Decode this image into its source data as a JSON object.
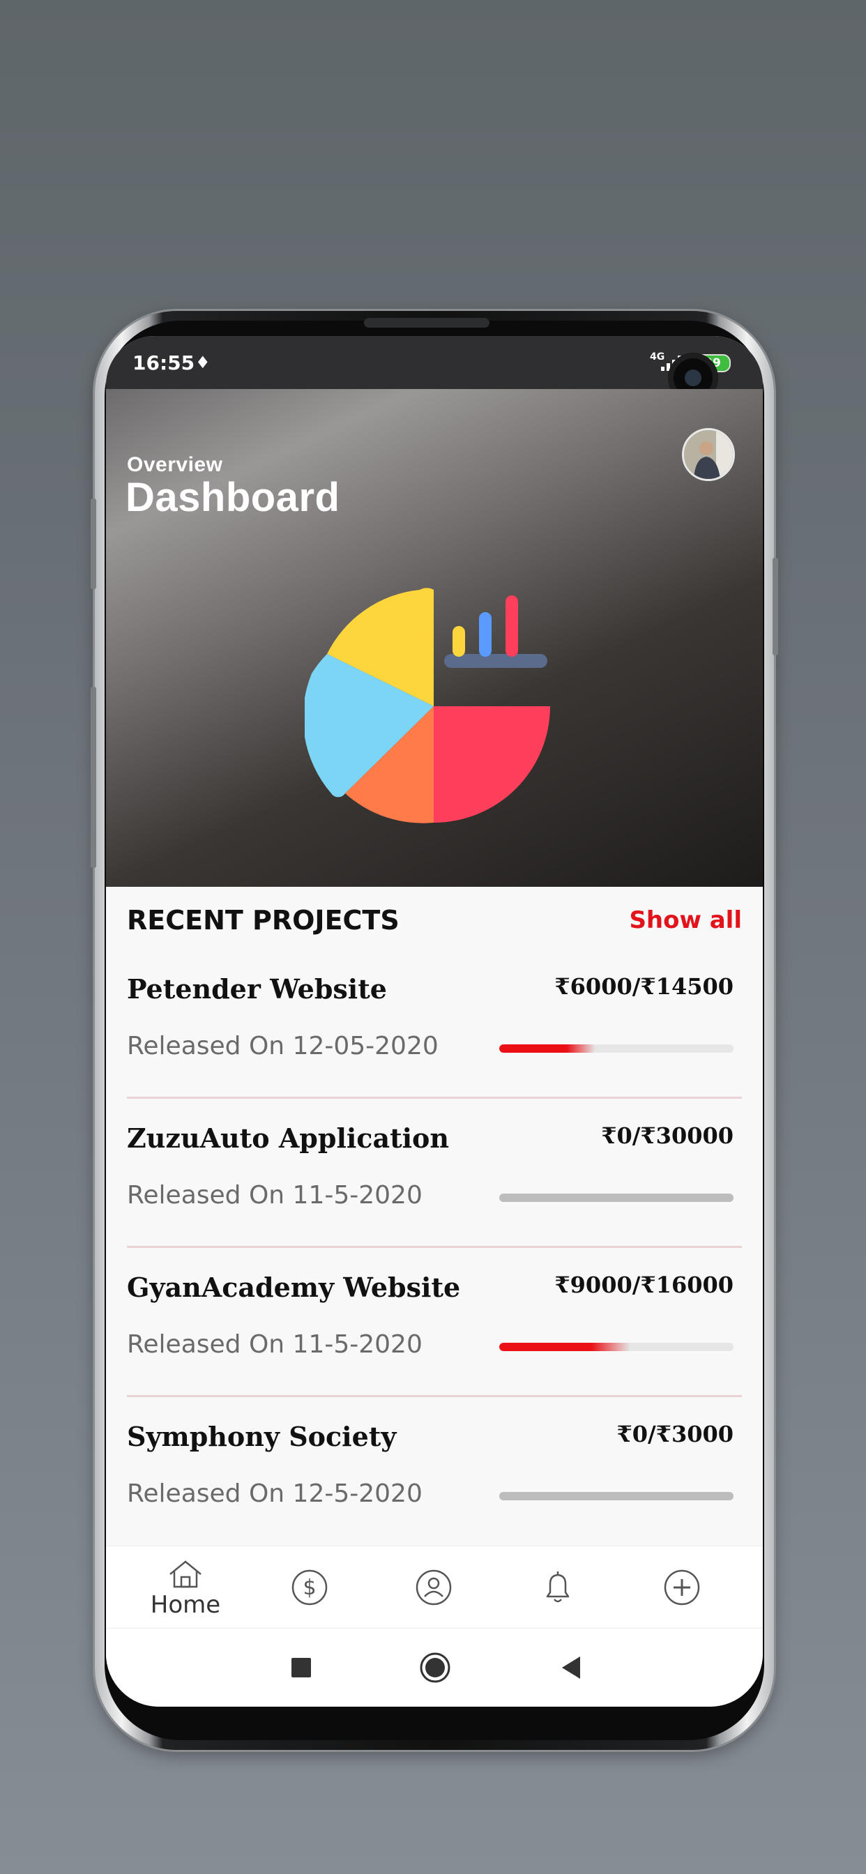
{
  "status_bar": {
    "time": "16:55",
    "network": "4G",
    "battery": "39"
  },
  "header": {
    "subtitle": "Overview",
    "title": "Dashboard"
  },
  "recent_projects": {
    "heading": "RECENT PROJECTS",
    "show_all_label": "Show all",
    "items": [
      {
        "name": "Petender Website",
        "amount": "₹6000/₹14500",
        "released": "Released On 12-05-2020",
        "progress": 0.41,
        "fill_color": "#ea1016"
      },
      {
        "name": "ZuzuAuto Application",
        "amount": "₹0/₹30000",
        "released": "Released On 11-5-2020",
        "progress": 0,
        "fill_color": "#ea1016"
      },
      {
        "name": "GyanAcademy Website",
        "amount": "₹9000/₹16000",
        "released": "Released On 11-5-2020",
        "progress": 0.56,
        "fill_color": "#ea1016"
      },
      {
        "name": "Symphony Society",
        "amount": "₹0/₹3000",
        "released": "Released On 12-5-2020",
        "progress": 0,
        "fill_color": "#ea1016"
      }
    ]
  },
  "tabbar": {
    "items": [
      {
        "icon": "home-icon",
        "label": "Home"
      },
      {
        "icon": "dollar-icon",
        "label": ""
      },
      {
        "icon": "user-icon",
        "label": ""
      },
      {
        "icon": "bell-icon",
        "label": ""
      },
      {
        "icon": "plus-circle-icon",
        "label": ""
      }
    ]
  },
  "navbar": {
    "icons": [
      "recents-icon",
      "home-circle-icon",
      "back-icon"
    ]
  },
  "colors": {
    "accent": "#e1141b",
    "status_bar": "#2f2f31",
    "pie_yellow": "#fdd63e",
    "pie_blue": "#7dd5f5",
    "pie_orange": "#ff7c4a",
    "pie_red": "#ff3f5b",
    "bar_blue": "#5b9bff",
    "bar_slate": "#5a6b8c"
  }
}
